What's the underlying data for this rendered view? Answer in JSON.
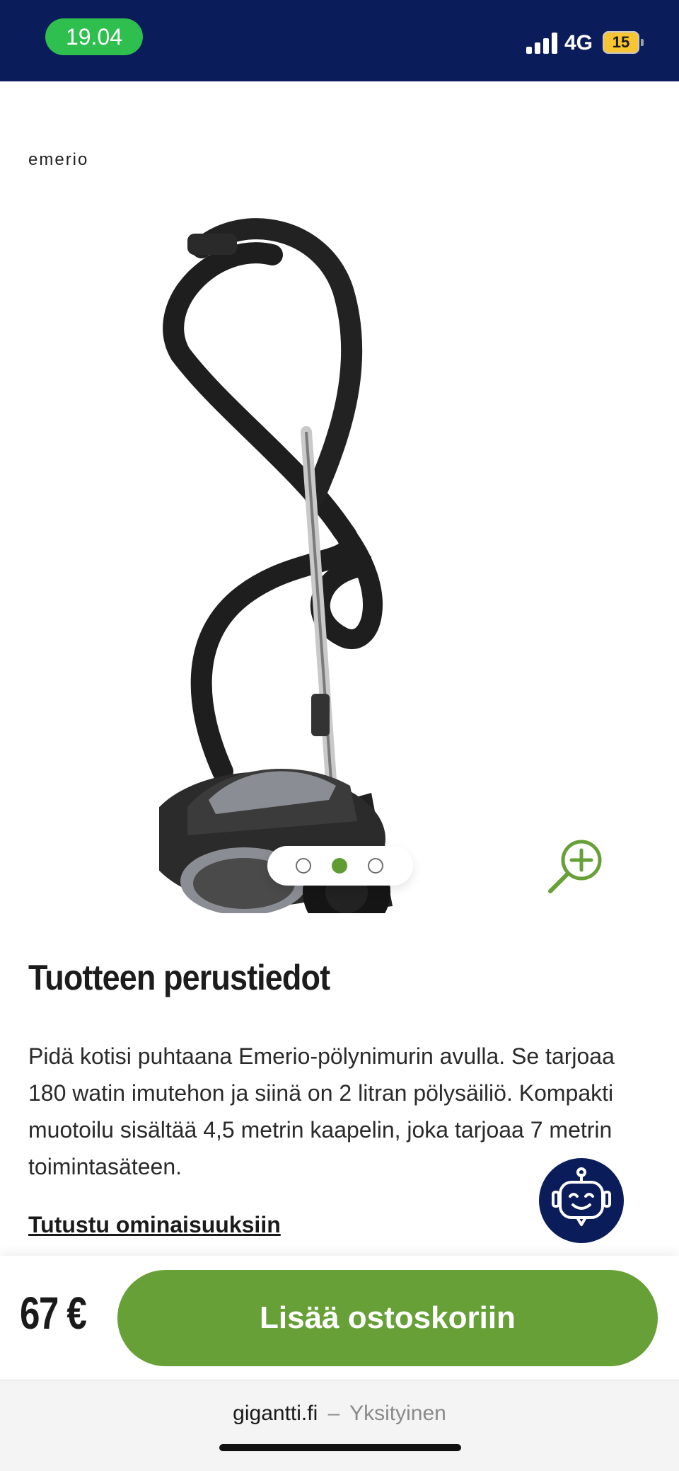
{
  "status_bar": {
    "time": "19.04",
    "network": "4G",
    "battery": "15"
  },
  "gallery": {
    "brand": "emerio",
    "image_icon": "vacuum-cleaner-image",
    "slide_count": 3,
    "active_slide": 2,
    "zoom_icon": "zoom-in-icon"
  },
  "product": {
    "section_title": "Tuotteen perustiedot",
    "description": "Pidä kotisi puhtaana Emerio-pölynimurin avulla. Se tarjoaa 180 watin imutehon ja siinä on 2 litran pölysäiliö. Kompakti muotoilu sisältää 4,5 metrin kaapelin, joka tarjoaa 7 metrin toimintasäteen.",
    "explore_link": "Tutustu ominaisuuksiin"
  },
  "chatbot": {
    "icon": "chatbot-robot-icon"
  },
  "buy_bar": {
    "price": "67 €",
    "add_to_cart_label": "Lisää ostoskoriin"
  },
  "browser": {
    "domain": "gigantti.fi",
    "separator": "–",
    "label": "Yksityinen"
  },
  "colors": {
    "header_navy": "#0b1c5a",
    "accent_green": "#66a037",
    "time_pill_green": "#2fbf4f"
  }
}
